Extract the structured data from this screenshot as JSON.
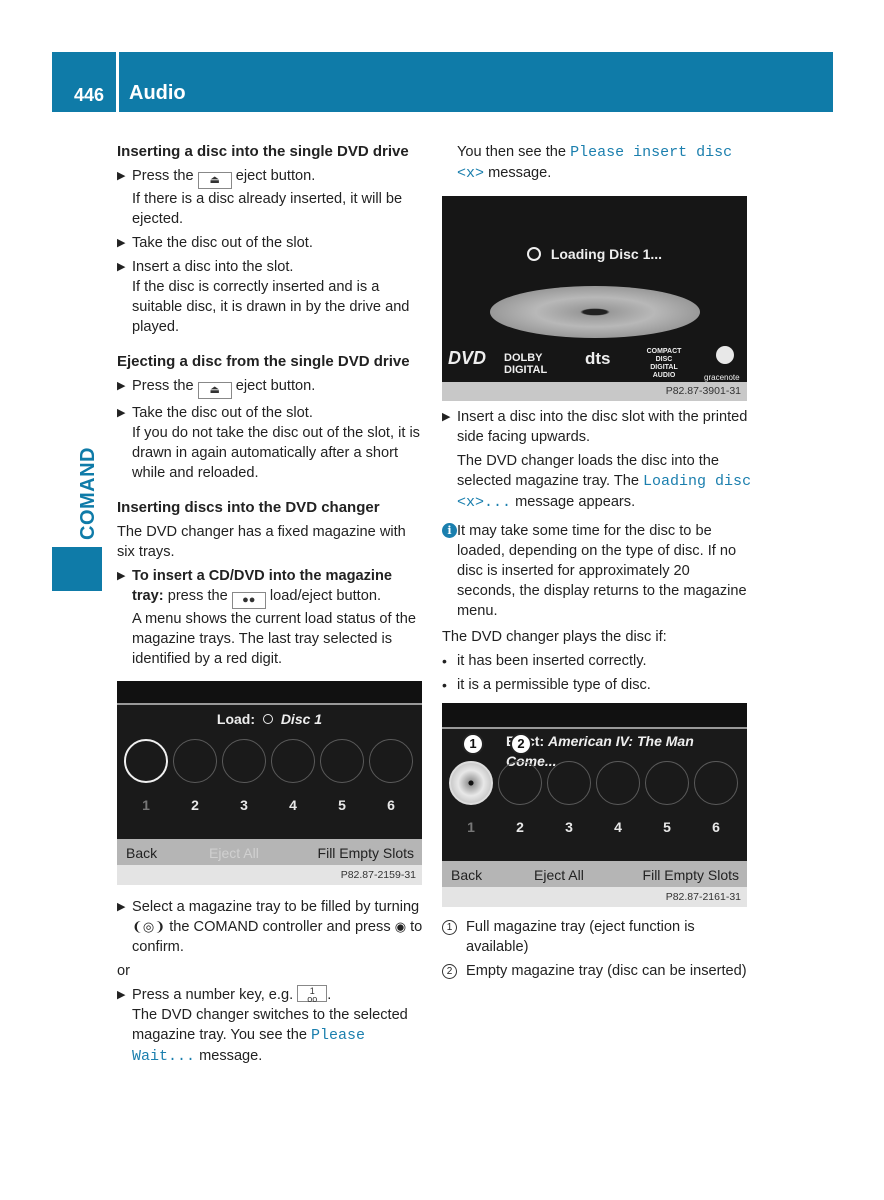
{
  "header": {
    "page_number": "446",
    "title": "Audio"
  },
  "side_tab": {
    "label": "COMAND"
  },
  "left": {
    "sec1": {
      "heading": "Inserting a disc into the single DVD drive",
      "step1_pre": "Press the",
      "step1_key": "eject-icon",
      "step1_post": "eject button.",
      "step1_note": "If there is a disc already inserted, it will be ejected.",
      "step2": "Take the disc out of the slot.",
      "step3": "Insert a disc into the slot.",
      "step3_note": "If the disc is correctly inserted and is a suitable disc, it is drawn in by the drive and played."
    },
    "sec2": {
      "heading": "Ejecting a disc from the single DVD drive",
      "step1_pre": "Press the",
      "step1_post": "eject button.",
      "step2": "Take the disc out of the slot.",
      "step2_note": "If you do not take the disc out of the slot, it is drawn in again automatically after a short while and reloaded."
    },
    "sec3": {
      "heading": "Inserting discs into the DVD changer",
      "intro": "The DVD changer has a fixed magazine with six trays.",
      "step1_bold": "To insert a CD/DVD into the magazine tray:",
      "step1_pre": "press the",
      "step1_post": "load/eject button.",
      "step1_note": "A menu shows the current load status of the magazine trays. The last tray selected is identified by a red digit."
    },
    "screen1": {
      "title_label": "Load:",
      "title_value": "Disc 1",
      "trays": [
        "1",
        "2",
        "3",
        "4",
        "5",
        "6"
      ],
      "back": "Back",
      "eject_all": "Eject All",
      "fill": "Fill Empty Slots",
      "ref": "P82.87-2159-31"
    },
    "sec4": {
      "step1_a": "Select a magazine tray to be filled by turning",
      "step1_b": "the COMAND controller and press",
      "step1_c": "to confirm.",
      "or": "or",
      "step2_pre": "Press a number key, e.g.",
      "step2_key_top": "1",
      "step2_key_bottom": "oo",
      "step2_post": ".",
      "step2_note_pre": "The DVD changer switches to the selected magazine tray. You see the",
      "step2_msg": "Please Wait...",
      "step2_note_post": "message."
    }
  },
  "right": {
    "intro_pre": "You then see the",
    "intro_msg": "Please insert disc <x>",
    "intro_post": "message.",
    "screen2": {
      "loading": "Loading Disc 1...",
      "logos": [
        "DVD",
        "DOLBY DIGITAL",
        "dts",
        "COMPACT DISC DIGITAL AUDIO",
        "gracenote"
      ],
      "ref": "P82.87-3901-31"
    },
    "step1": "Insert a disc into the disc slot with the printed side facing upwards.",
    "step1_note_pre": "The DVD changer loads the disc into the selected magazine tray. The",
    "step1_msg": "Loading disc <x>...",
    "step1_note_post": "message appears.",
    "info": "It may take some time for the disc to be loaded, depending on the type of disc. If no disc is inserted for approximately 20 seconds, the display returns to the magazine menu.",
    "plays_if": "The DVD changer plays the disc if:",
    "bullets": [
      "it has been inserted correctly.",
      "it is a permissible type of disc."
    ],
    "screen3": {
      "title_label": "Eject:",
      "title_value": "American IV: The Man Come...",
      "trays": [
        "1",
        "2",
        "3",
        "4",
        "5",
        "6"
      ],
      "callouts": [
        "1",
        "2"
      ],
      "back": "Back",
      "eject_all": "Eject All",
      "fill": "Fill Empty Slots",
      "ref": "P82.87-2161-31"
    },
    "legend": [
      {
        "num": "1",
        "text": "Full magazine tray (eject function is available)"
      },
      {
        "num": "2",
        "text": "Empty magazine tray (disc can be inserted)"
      }
    ]
  }
}
